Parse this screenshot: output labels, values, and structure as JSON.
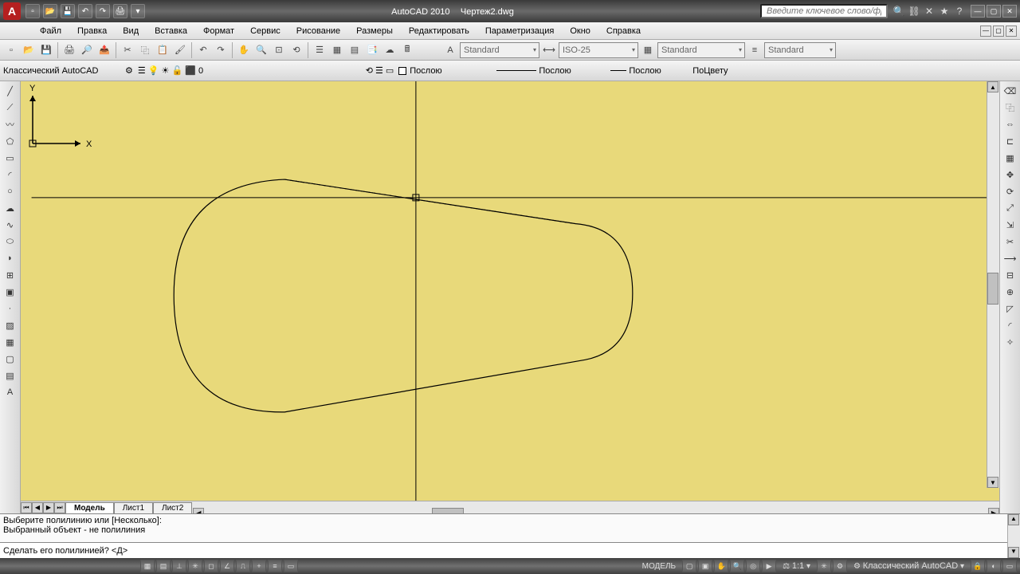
{
  "app": {
    "name": "AutoCAD 2010",
    "doc": "Чертеж2.dwg",
    "search_placeholder": "Введите ключевое слово/фразу"
  },
  "menu": {
    "items": [
      "Файл",
      "Правка",
      "Вид",
      "Вставка",
      "Формат",
      "Сервис",
      "Рисование",
      "Размеры",
      "Редактировать",
      "Параметризация",
      "Окно",
      "Справка"
    ]
  },
  "toolbar2": {
    "workspace": "Классический AutoCAD",
    "layer": "0",
    "textstyle": "Standard",
    "dimstyle": "ISO-25",
    "tablestyle": "Standard",
    "mlstyle": "Standard",
    "color": "Послою",
    "ltype": "Послою",
    "lweight": "Послою",
    "plotstyle": "ПоЦвету"
  },
  "tabs": {
    "model": "Модель",
    "l1": "Лист1",
    "l2": "Лист2"
  },
  "cmd": {
    "h1": "Выберите полилинию или [Несколько]:",
    "h2": "Выбранный объект - не полилиния",
    "prompt": "Сделать его полилинией? <Д>"
  },
  "status": {
    "model": "МОДЕЛЬ",
    "scale": "1:1",
    "ws": "Классический AutoCAD"
  },
  "ucs": {
    "x": "X",
    "y": "Y"
  }
}
